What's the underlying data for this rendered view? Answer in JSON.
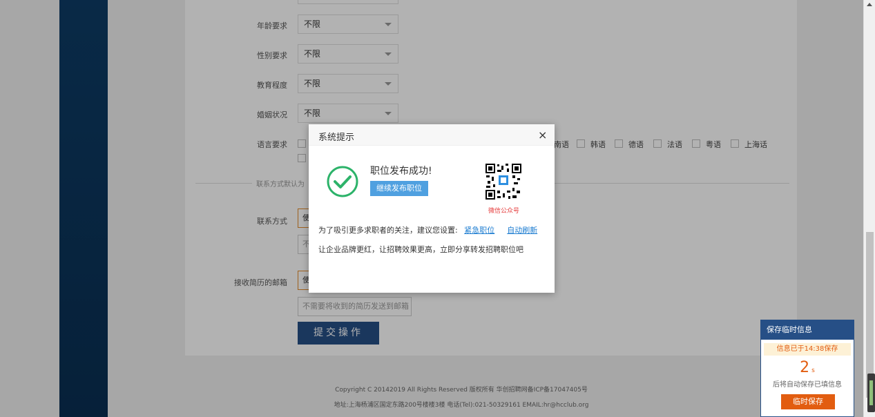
{
  "form": {
    "rows": [
      {
        "label": "年龄要求",
        "value": "不限"
      },
      {
        "label": "性别要求",
        "value": "不限"
      },
      {
        "label": "教育程度",
        "value": "不限"
      },
      {
        "label": "婚姻状况",
        "value": "不限"
      }
    ],
    "language_label": "语言要求",
    "languages": [
      "韩语",
      "韩语",
      "德语",
      "法语",
      "粤语",
      "上海话"
    ],
    "language_partial": "南语",
    "divider_text": "联系方式默认为",
    "contact_label": "联系方式",
    "contact_value": "使",
    "contact_second": "不",
    "email_label": "接收简历的邮箱",
    "email_value": "使",
    "email_placeholder": "不需要将收到的简历发送到邮箱",
    "submit_label": "提交操作"
  },
  "footer": {
    "copyright": "Copyright C 20142019 All Rights Reserved 版权所有 华创招聘网备ICP备17047405号",
    "address": "地址:上海杨浦区国定东路200号楼楼3楼 电话(Tel):021-50329161 EMAIL:hr@hcclub.org"
  },
  "modal": {
    "title": "系统提示",
    "close": "×",
    "success": "职位发布成功!",
    "continue_label": "继续发布职位",
    "qr_caption": "微信公众号",
    "suggest_prefix": "为了吸引更多求职者的关注，建议您设置:",
    "link_urgent": "紧急职位",
    "link_refresh": "自动刷新",
    "share_text": "让企业品牌更红，让招聘效果更高，立即分享转发招聘职位吧"
  },
  "save_panel": {
    "title": "保存临时信息",
    "status": "信息已于14:38保存",
    "countdown": "2",
    "unit": "s",
    "auto_text": "后将自动保存已填信息",
    "button": "临时保存"
  },
  "colors": {
    "primary": "#264f86",
    "orange": "#e25d10",
    "link": "#1a7bd0",
    "success_green": "#2db36a"
  }
}
